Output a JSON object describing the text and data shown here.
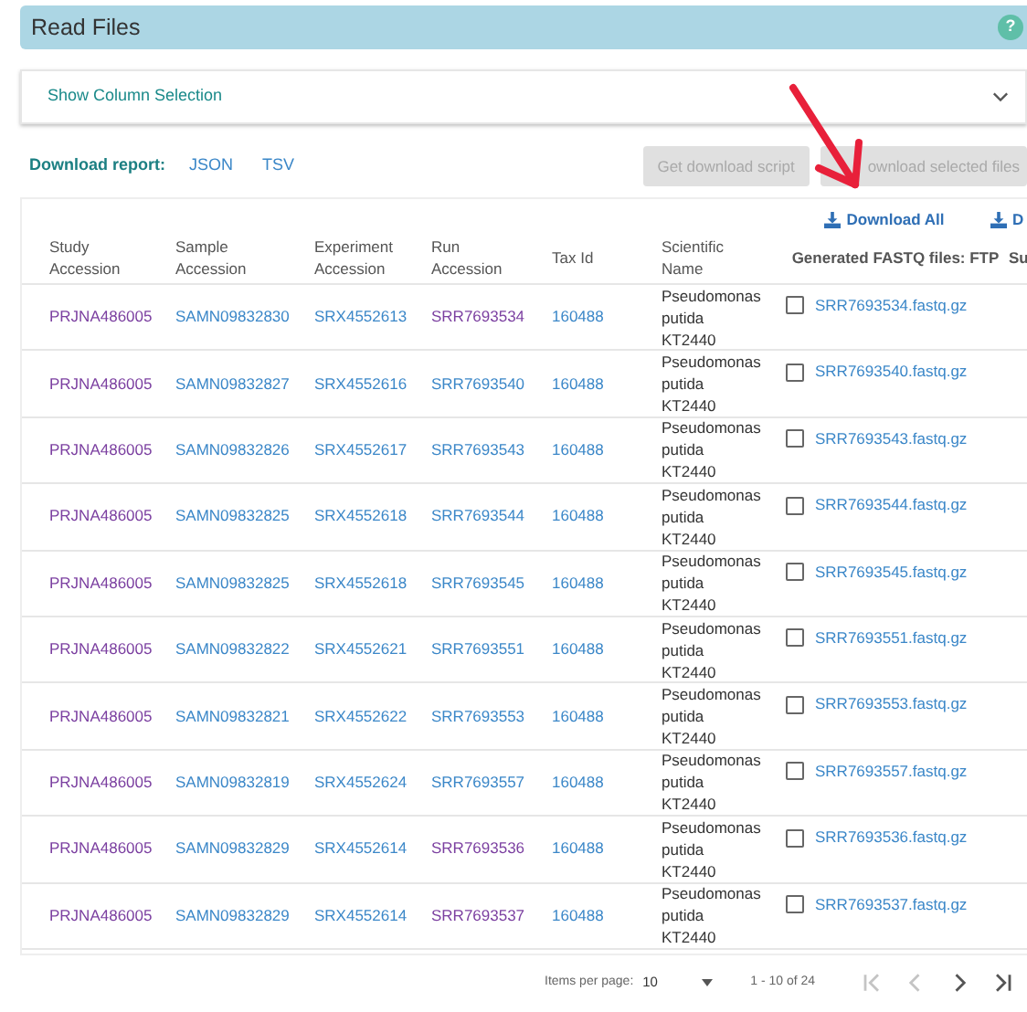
{
  "panel": {
    "title": "Read Files",
    "help": "?"
  },
  "column_selection": {
    "label": "Show Column Selection",
    "expanded": false
  },
  "download_report": {
    "label": "Download report:",
    "links": [
      "JSON",
      "TSV"
    ]
  },
  "buttons": [
    {
      "label": "Get download script",
      "disabled": true
    },
    {
      "label": "ownload selected files",
      "disabled": true
    }
  ],
  "download_links": [
    "Download All",
    "D"
  ],
  "columns": [
    "Study Accession",
    "Sample Accession",
    "Experiment Accession",
    "Run Accession",
    "Tax Id",
    "Scientific Name",
    "Generated FASTQ files: FTP",
    "Su"
  ],
  "rows": [
    {
      "study": "PRJNA486005",
      "study_visited": true,
      "sample": "SAMN09832830",
      "experiment": "SRX4552613",
      "run": "SRR7693534",
      "run_visited": true,
      "tax": "160488",
      "name": "Pseudomonas putida KT2440",
      "file": "SRR7693534.fastq.gz",
      "checked": false
    },
    {
      "study": "PRJNA486005",
      "study_visited": true,
      "sample": "SAMN09832827",
      "experiment": "SRX4552616",
      "run": "SRR7693540",
      "run_visited": false,
      "tax": "160488",
      "name": "Pseudomonas putida KT2440",
      "file": "SRR7693540.fastq.gz",
      "checked": false
    },
    {
      "study": "PRJNA486005",
      "study_visited": true,
      "sample": "SAMN09832826",
      "experiment": "SRX4552617",
      "run": "SRR7693543",
      "run_visited": false,
      "tax": "160488",
      "name": "Pseudomonas putida KT2440",
      "file": "SRR7693543.fastq.gz",
      "checked": false
    },
    {
      "study": "PRJNA486005",
      "study_visited": true,
      "sample": "SAMN09832825",
      "experiment": "SRX4552618",
      "run": "SRR7693544",
      "run_visited": false,
      "tax": "160488",
      "name": "Pseudomonas putida KT2440",
      "file": "SRR7693544.fastq.gz",
      "checked": false
    },
    {
      "study": "PRJNA486005",
      "study_visited": true,
      "sample": "SAMN09832825",
      "experiment": "SRX4552618",
      "run": "SRR7693545",
      "run_visited": false,
      "tax": "160488",
      "name": "Pseudomonas putida KT2440",
      "file": "SRR7693545.fastq.gz",
      "checked": false
    },
    {
      "study": "PRJNA486005",
      "study_visited": true,
      "sample": "SAMN09832822",
      "experiment": "SRX4552621",
      "run": "SRR7693551",
      "run_visited": false,
      "tax": "160488",
      "name": "Pseudomonas putida KT2440",
      "file": "SRR7693551.fastq.gz",
      "checked": false
    },
    {
      "study": "PRJNA486005",
      "study_visited": true,
      "sample": "SAMN09832821",
      "experiment": "SRX4552622",
      "run": "SRR7693553",
      "run_visited": false,
      "tax": "160488",
      "name": "Pseudomonas putida KT2440",
      "file": "SRR7693553.fastq.gz",
      "checked": false
    },
    {
      "study": "PRJNA486005",
      "study_visited": true,
      "sample": "SAMN09832819",
      "experiment": "SRX4552624",
      "run": "SRR7693557",
      "run_visited": false,
      "tax": "160488",
      "name": "Pseudomonas putida KT2440",
      "file": "SRR7693557.fastq.gz",
      "checked": false
    },
    {
      "study": "PRJNA486005",
      "study_visited": true,
      "sample": "SAMN09832829",
      "experiment": "SRX4552614",
      "run": "SRR7693536",
      "run_visited": true,
      "tax": "160488",
      "name": "Pseudomonas putida KT2440",
      "file": "SRR7693536.fastq.gz",
      "checked": false
    },
    {
      "study": "PRJNA486005",
      "study_visited": true,
      "sample": "SAMN09832829",
      "experiment": "SRX4552614",
      "run": "SRR7693537",
      "run_visited": true,
      "tax": "160488",
      "name": "Pseudomonas putida KT2440",
      "file": "SRR7693537.fastq.gz",
      "checked": false
    }
  ],
  "pagination": {
    "label": "Items per page:",
    "per_page": "10",
    "range": "1 - 10 of 24",
    "nav": [
      {
        "kind": "first",
        "disabled": true
      },
      {
        "kind": "prev",
        "disabled": true
      },
      {
        "kind": "next",
        "disabled": false
      },
      {
        "kind": "last",
        "disabled": false
      }
    ]
  }
}
